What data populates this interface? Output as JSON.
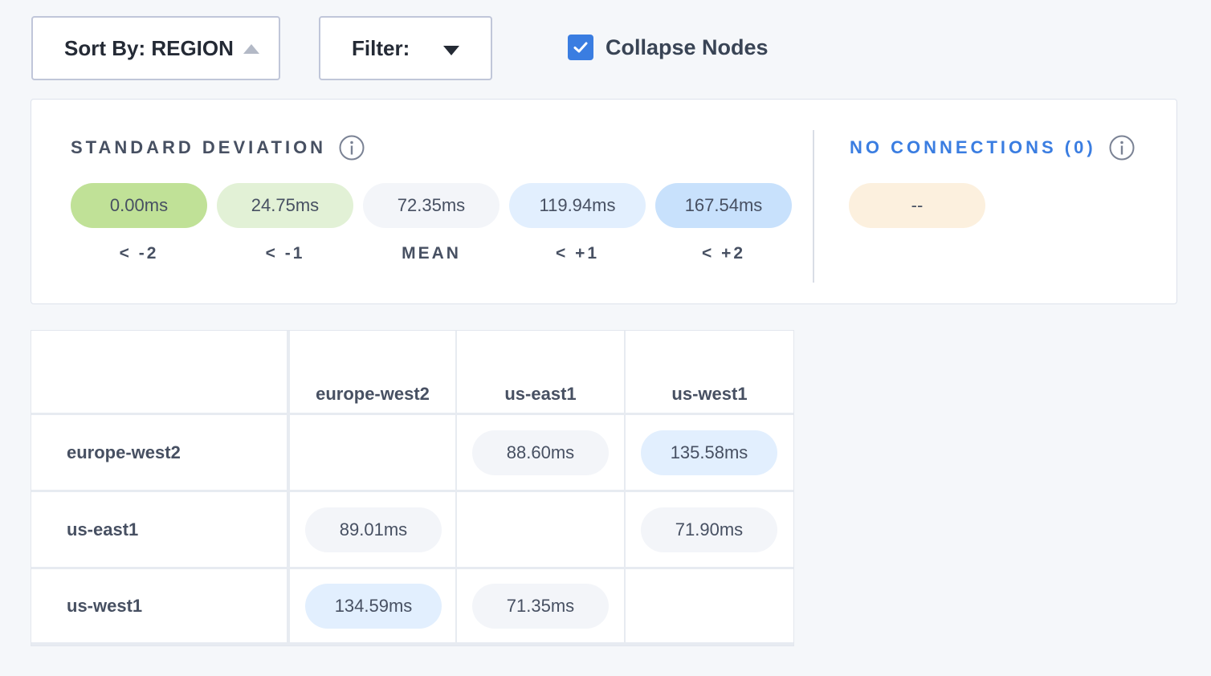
{
  "controls": {
    "sort_label": "Sort By: REGION",
    "filter_label": "Filter:",
    "collapse_label": "Collapse Nodes",
    "collapse_checked": true
  },
  "legend": {
    "std_title": "STANDARD DEVIATION",
    "bins": [
      {
        "value": "0.00ms",
        "label": "< -2",
        "color": "#c0e197"
      },
      {
        "value": "24.75ms",
        "label": "< -1",
        "color": "#e2f1d6"
      },
      {
        "value": "72.35ms",
        "label": "MEAN",
        "color": "#f3f5f9"
      },
      {
        "value": "119.94ms",
        "label": "< +1",
        "color": "#e2effe"
      },
      {
        "value": "167.54ms",
        "label": "< +2",
        "color": "#c8e1fc"
      }
    ],
    "no_conn_title": "NO CONNECTIONS (0)",
    "no_conn_value": "--",
    "no_conn_color": "#fcf0de"
  },
  "matrix": {
    "columns": [
      "europe-west2",
      "us-east1",
      "us-west1"
    ],
    "rows": [
      {
        "name": "europe-west2",
        "cells": [
          {
            "value": "",
            "color": ""
          },
          {
            "value": "88.60ms",
            "color": "#f3f5f9"
          },
          {
            "value": "135.58ms",
            "color": "#e2effe"
          }
        ]
      },
      {
        "name": "us-east1",
        "cells": [
          {
            "value": "89.01ms",
            "color": "#f3f5f9"
          },
          {
            "value": "",
            "color": ""
          },
          {
            "value": "71.90ms",
            "color": "#f3f5f9"
          }
        ]
      },
      {
        "name": "us-west1",
        "cells": [
          {
            "value": "134.59ms",
            "color": "#e2effe"
          },
          {
            "value": "71.35ms",
            "color": "#f3f5f9"
          },
          {
            "value": "",
            "color": ""
          }
        ]
      }
    ]
  },
  "colors": {
    "accent": "#3a7de1"
  }
}
